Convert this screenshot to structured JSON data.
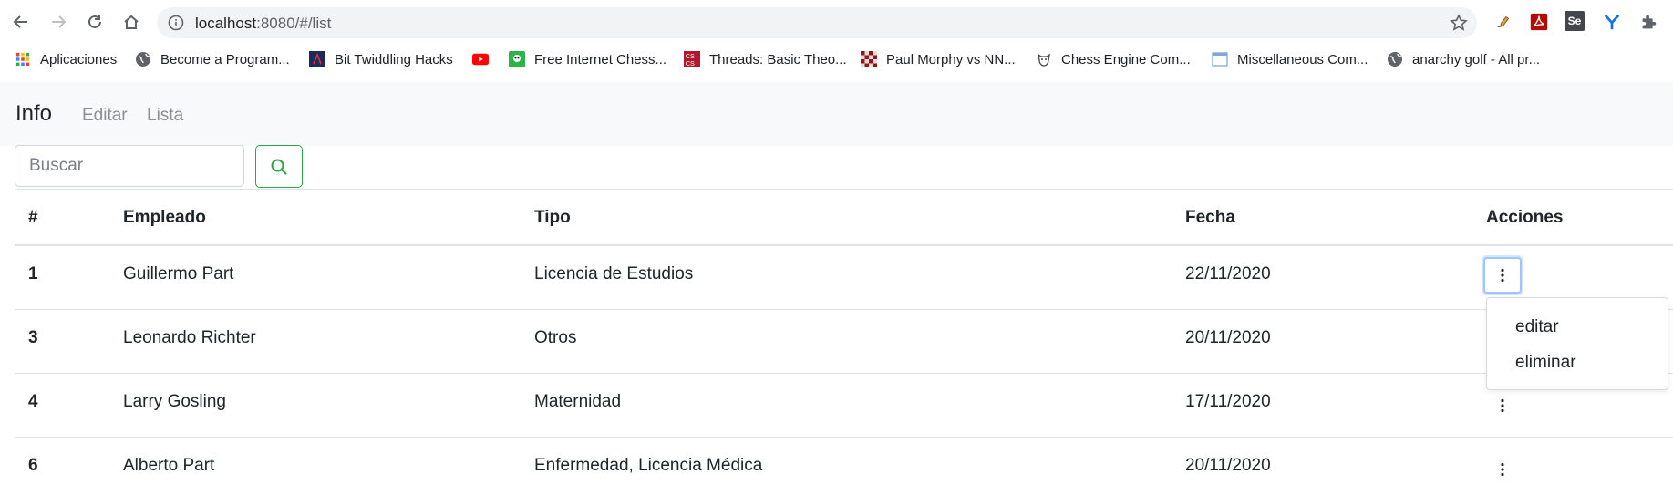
{
  "browser": {
    "url_host": "localhost",
    "url_path": ":8080/#/list",
    "bookmarks": [
      {
        "label": "Aplicaciones",
        "icon": "apps-grid-icon"
      },
      {
        "label": "Become a Program...",
        "icon": "globe-icon"
      },
      {
        "label": "Bit Twiddling Hacks",
        "icon": "bit-twiddling-icon"
      },
      {
        "label": "",
        "icon": "youtube-icon"
      },
      {
        "label": "Free Internet Chess...",
        "icon": "chess-icon"
      },
      {
        "label": "Threads: Basic Theo...",
        "icon": "cs-icon"
      },
      {
        "label": "Paul Morphy vs NN...",
        "icon": "chessboard-icon"
      },
      {
        "label": "Chess Engine Com...",
        "icon": "engine-icon"
      },
      {
        "label": "Miscellaneous Com...",
        "icon": "page-icon"
      },
      {
        "label": "anarchy golf - All pr...",
        "icon": "globe-icon"
      }
    ],
    "extensions": [
      "brush-extension-icon",
      "pdf-extension-icon",
      "selenium-extension-icon",
      "y-extension-icon",
      "puzzle-extension-icon"
    ],
    "selenium_label": "Se"
  },
  "navbar": {
    "brand": "Info",
    "links": [
      "Editar",
      "Lista"
    ]
  },
  "search": {
    "placeholder": "Buscar",
    "value": ""
  },
  "table": {
    "headers": [
      "#",
      "Empleado",
      "Tipo",
      "Fecha",
      "Acciones"
    ],
    "rows": [
      {
        "id": "1",
        "empleado": "Guillermo Part",
        "tipo": "Licencia de Estudios",
        "fecha": "22/11/2020"
      },
      {
        "id": "3",
        "empleado": "Leonardo Richter",
        "tipo": "Otros",
        "fecha": "20/11/2020"
      },
      {
        "id": "4",
        "empleado": "Larry Gosling",
        "tipo": "Maternidad",
        "fecha": "17/11/2020"
      },
      {
        "id": "6",
        "empleado": "Alberto Part",
        "tipo": "Enfermedad, Licencia Médica",
        "fecha": "20/11/2020"
      }
    ]
  },
  "dropdown": {
    "items": [
      "editar",
      "eliminar"
    ]
  },
  "colors": {
    "accent_green": "#28a745",
    "focus_ring": "#9ec5fe",
    "navbar_bg": "#f8f9fa"
  }
}
